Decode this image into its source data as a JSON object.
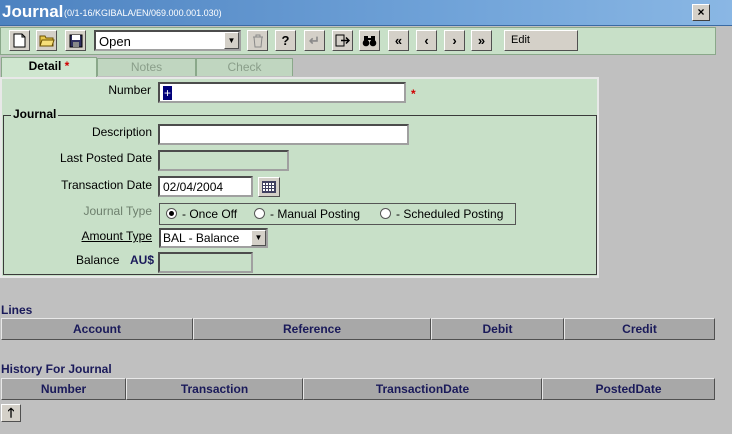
{
  "window": {
    "title": "Journal",
    "subtitle": "(0/1-16/KGIBALA/EN/069.000.001.030)",
    "close_label": "×"
  },
  "toolbar": {
    "mode_value": "Open",
    "edit_label": "Edit",
    "icons": [
      "new-document-icon",
      "open-folder-icon",
      "save-icon",
      "delete-icon",
      "help-icon",
      "back-icon",
      "exit-icon",
      "find-binoculars-icon",
      "first-record-icon",
      "previous-record-icon",
      "next-record-icon",
      "last-record-icon"
    ]
  },
  "tabs": [
    {
      "label": "Detail",
      "required_mark": "*",
      "active": true
    },
    {
      "label": "Notes",
      "active": false
    },
    {
      "label": "Check",
      "active": false
    }
  ],
  "detail": {
    "number_label": "Number",
    "number_value": "+",
    "number_required": "*",
    "group_label": "Journal",
    "description_label": "Description",
    "description_value": "",
    "last_posted_label": "Last Posted Date",
    "last_posted_value": "",
    "transaction_date_label": "Transaction Date",
    "transaction_date_value": "02/04/2004",
    "journal_type_label": "Journal Type",
    "journal_type_options": [
      "- Once Off",
      "- Manual Posting",
      "- Scheduled Posting"
    ],
    "journal_type_selected": "- Once Off",
    "amount_type_label": "Amount Type",
    "amount_type_value": "BAL - Balance",
    "balance_label": "Balance",
    "balance_currency": "AU$",
    "balance_value": ""
  },
  "lines": {
    "title": "Lines",
    "columns": [
      "Account",
      "Reference",
      "Debit",
      "Credit"
    ]
  },
  "history": {
    "title": "History For Journal",
    "columns": [
      "Number",
      "Transaction",
      "TransactionDate",
      "PostedDate"
    ]
  },
  "colors": {
    "title_bar": "#4d82c0",
    "panel_green": "#c8e0c8",
    "required_red": "#d00000",
    "header_text": "#1a1a5a"
  }
}
